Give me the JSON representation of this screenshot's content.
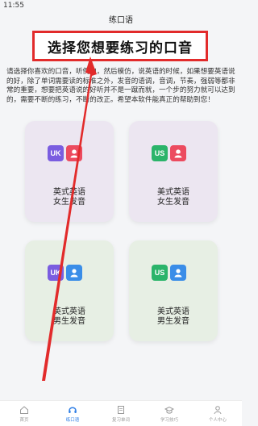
{
  "status_bar": {
    "time": "11:55"
  },
  "title_bar": {
    "title": "练口语"
  },
  "banner": {
    "text": "选择您想要练习的口音"
  },
  "intro": "请选择你喜欢的口音，听例句，然后模仿，说英语的时候，如果想要英语说的好，除了单词需要读的标准之外，发音的语调，音调，节奏，强弱等都非常的重要，想要把英语说的好听并不是一蹴而就，一个步的努力就可以达到的，需要不断的练习，不断的改正。希望本软件能真正的帮助到您！",
  "cards": [
    {
      "region_badge": "UK",
      "label_line1": "英式英语",
      "label_line2": "女生发音"
    },
    {
      "region_badge": "US",
      "label_line1": "美式英语",
      "label_line2": "女生发音"
    },
    {
      "region_badge": "UK",
      "label_line1": "英式英语",
      "label_line2": "男生发音"
    },
    {
      "region_badge": "US",
      "label_line1": "美式英语",
      "label_line2": "男生发音"
    }
  ],
  "tabs": [
    {
      "label": "首页",
      "icon": "home-icon",
      "active": false
    },
    {
      "label": "练口语",
      "icon": "headset-icon",
      "active": true
    },
    {
      "label": "复习单词",
      "icon": "notebook-icon",
      "active": false
    },
    {
      "label": "学习技巧",
      "icon": "graduation-icon",
      "active": false
    },
    {
      "label": "个人中心",
      "icon": "person-icon",
      "active": false
    }
  ],
  "colors": {
    "banner_border": "#e22b2b",
    "arrow": "#e22b2b",
    "female_card_bg": "#ece6f1",
    "male_card_bg": "#e7efe4",
    "uk_badge": "#7a5de0",
    "us_badge": "#2bb46a",
    "female_badge": "#ec4b5f",
    "male_badge": "#3a8de8",
    "tab_active": "#2f7fe6"
  }
}
